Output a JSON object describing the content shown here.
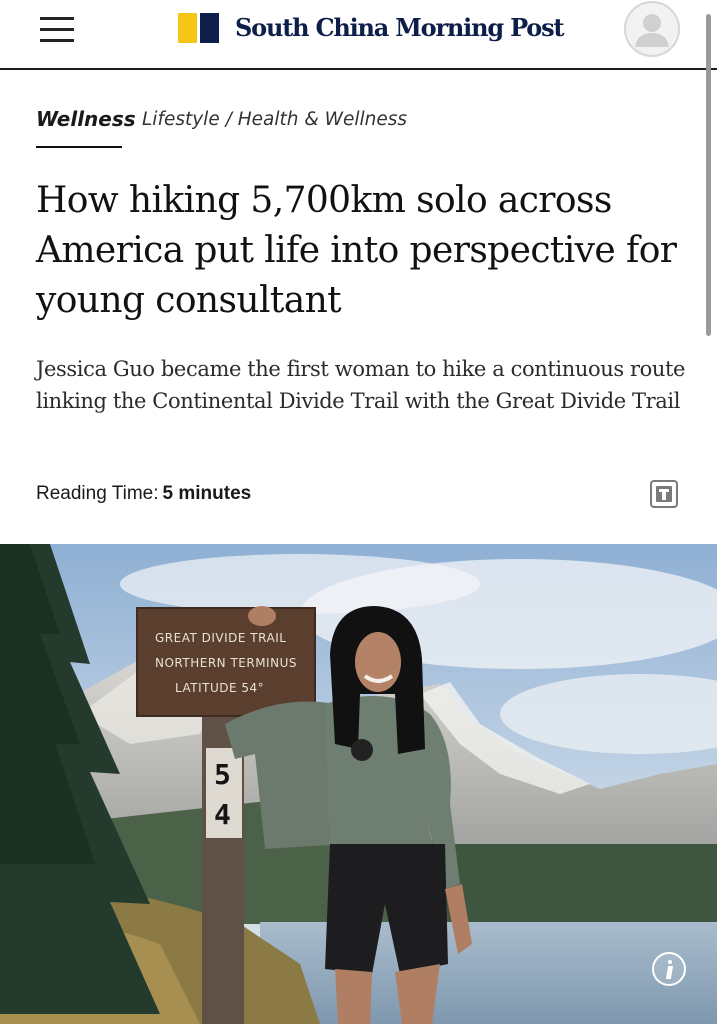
{
  "header": {
    "brand_name": "South China Morning Post",
    "brand_colors": {
      "yellow": "#f5c518",
      "navy": "#0d1e4a"
    },
    "menu_icon": "hamburger-menu-icon",
    "account_icon": "user-avatar-icon"
  },
  "section": {
    "tag": "Wellness",
    "breadcrumb": [
      "Lifestyle",
      "Health & Wellness"
    ],
    "breadcrumb_separator": " / "
  },
  "article": {
    "headline": "How hiking 5,700km solo across America put life into perspective for young consultant",
    "standfirst": "Jessica Guo became the first woman to hike a continuous route linking the Continental Divide Trail with the Great Divide Trail",
    "reading_time_label": "Reading Time:",
    "reading_time_value": "5 minutes",
    "text_size_icon": "text-size-icon"
  },
  "hero": {
    "sign_lines": [
      "GREAT DIVIDE TRAIL",
      "NORTHERN TERMINUS",
      "LATITUDE 54°"
    ],
    "post_number": [
      "5",
      "4"
    ],
    "info_icon": "info-icon"
  }
}
